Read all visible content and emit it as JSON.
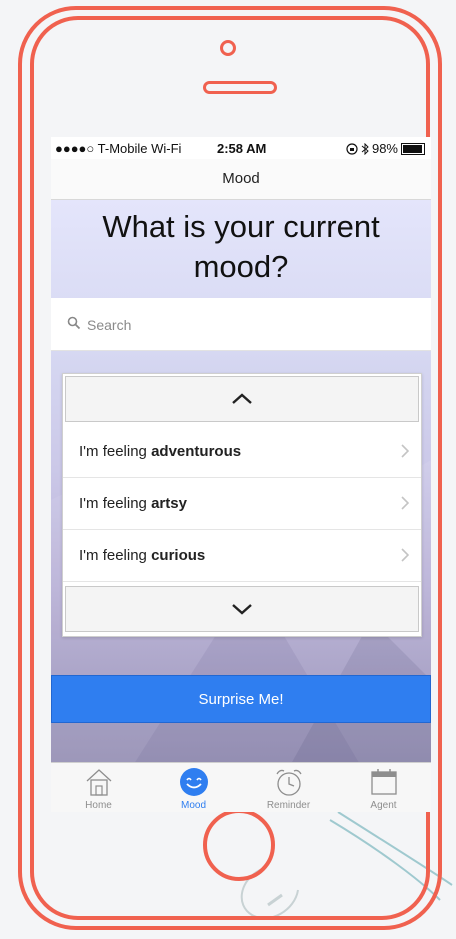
{
  "status_bar": {
    "carrier": "●●●●○ T-Mobile Wi-Fi",
    "time": "2:58 AM",
    "battery": "98%"
  },
  "nav": {
    "title": "Mood"
  },
  "question": "What is your current mood?",
  "search": {
    "placeholder": "Search",
    "value": ""
  },
  "moods": [
    {
      "prefix": "I'm feeling ",
      "mood": "adventurous"
    },
    {
      "prefix": "I'm feeling ",
      "mood": "artsy"
    },
    {
      "prefix": "I'm feeling ",
      "mood": "curious"
    }
  ],
  "surprise_label": "Surprise Me!",
  "tabs": [
    {
      "label": "Home",
      "icon": "home-icon"
    },
    {
      "label": "Mood",
      "icon": "smiley-icon",
      "active": true
    },
    {
      "label": "Reminder",
      "icon": "alarm-clock-icon"
    },
    {
      "label": "Agent",
      "icon": "calendar-icon"
    }
  ],
  "colors": {
    "frame": "#f0614f",
    "accent": "#2f7ef0"
  }
}
